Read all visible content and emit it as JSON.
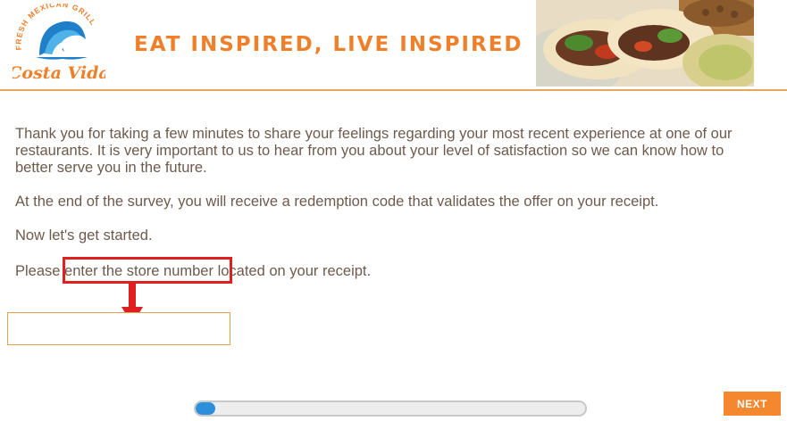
{
  "header": {
    "logo": {
      "brand": "Costa Vida",
      "arc_text": "FRESH MEXICAN GRILL",
      "icon": "wave-logo-icon"
    },
    "tagline": "EAT INSPIRED, LIVE INSPIRED",
    "photo_icon": "tacos-photo-icon"
  },
  "content": {
    "intro": "Thank you for taking a few minutes to share your feelings regarding your most recent experience at one of our restaurants. It is very important to us to hear from you about your level of satisfaction so we can know how to better serve you in the future.",
    "offer_note": "At the end of the survey, you will receive a redemption code that validates the offer on your receipt.",
    "start_note": "Now let's get started.",
    "store_prompt": {
      "prefix": "Please ",
      "highlight": "enter the store number",
      "suffix": " located on your receipt."
    }
  },
  "store_input": {
    "value": "",
    "placeholder": ""
  },
  "annotation": {
    "box_color": "#e02020",
    "arrow_icon": "down-arrow-icon"
  },
  "progress": {
    "fraction": 0.05
  },
  "navigation": {
    "next_label": "NEXT"
  },
  "colors": {
    "brand_orange": "#f07f2a",
    "button_orange": "#f5872f",
    "text_brown": "#6e5a4c",
    "progress_blue": "#2c8fdc"
  }
}
